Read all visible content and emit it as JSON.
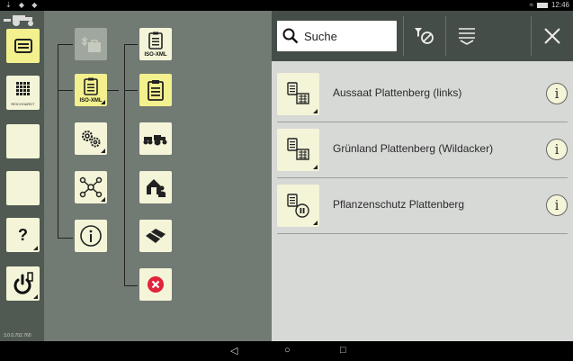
{
  "statusbar": {
    "left_icons": "⇣ ◆ ◆",
    "time": "12:46"
  },
  "version": "3.0.0.702.760",
  "sidebar": {
    "reichhardt_label": "REICHHARDT",
    "help_label": "?"
  },
  "tree": {
    "isoxml_label": "ISO-XML",
    "isoxml_sub_label": "ISO-XML"
  },
  "search": {
    "placeholder": "Suche",
    "value": ""
  },
  "tasks": [
    {
      "name": "Aussaat Plattenberg (links)"
    },
    {
      "name": "Grünland Plattenberg (Wildacker)"
    },
    {
      "name": "Pflanzenschutz Plattenberg"
    }
  ],
  "colors": {
    "active_tile": "#f3f08e",
    "tile": "#f4f4d8",
    "close_red": "#e0243a"
  }
}
